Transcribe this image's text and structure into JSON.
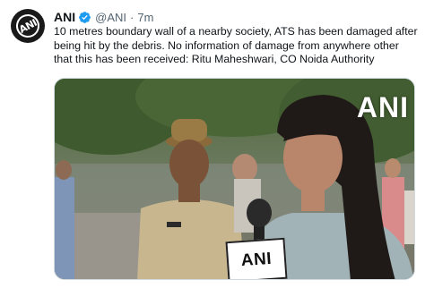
{
  "tweet": {
    "author_name": "ANI",
    "handle": "@ANI",
    "separator": "·",
    "time": "7m",
    "text": "10 metres boundary wall of a nearby society, ATS has been damaged after being hit by the debris. No information of damage from anywhere other that this has been received: Ritu Maheshwari, CO Noida Authority"
  },
  "avatar": {
    "logo_text": "ANI"
  },
  "media": {
    "watermark": "ANI",
    "mic_logo": "ANI"
  },
  "colors": {
    "verified": "#1d9bf0",
    "text": "#0f1419",
    "secondary": "#536471"
  },
  "icons": [
    "verified-badge-icon"
  ]
}
